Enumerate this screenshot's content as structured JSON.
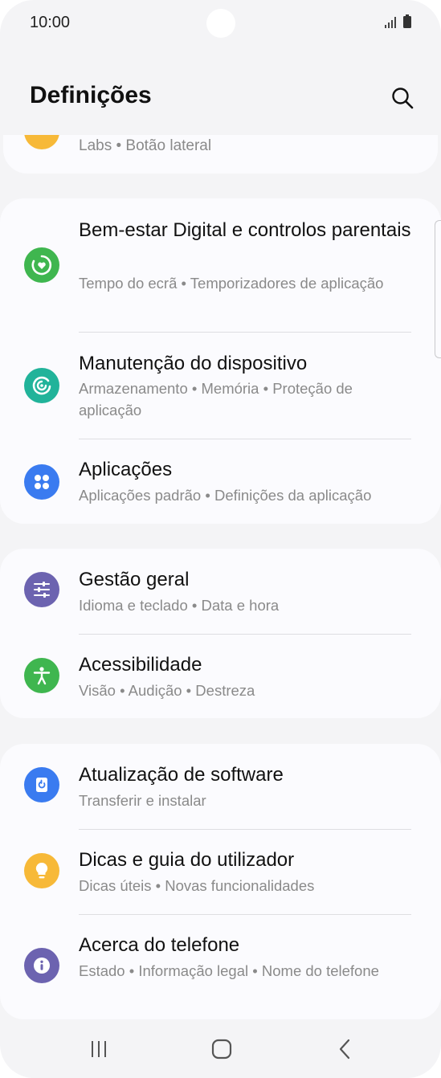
{
  "status": {
    "time": "10:00"
  },
  "header": {
    "title": "Definições"
  },
  "partial_item": {
    "subtitle": "Labs  •  Botão lateral"
  },
  "groups": [
    {
      "items": [
        {
          "title": "Bem-estar Digital e controlos parentais",
          "subtitle": "Tempo do ecrã  •  Temporizadores de aplicação",
          "icon": "digital-wellbeing-icon",
          "color": "#3fb64f"
        },
        {
          "title": "Manutenção do dispositivo",
          "subtitle": "Armazenamento  •  Memória  •  Proteção de aplicação",
          "icon": "device-care-icon",
          "color": "#21b39a"
        },
        {
          "title": "Aplicações",
          "subtitle": "Aplicações padrão  •  Definições da aplicação",
          "icon": "apps-icon",
          "color": "#3a7bf0"
        }
      ]
    },
    {
      "items": [
        {
          "title": "Gestão geral",
          "subtitle": "Idioma e teclado  •  Data e hora",
          "icon": "general-management-icon",
          "color": "#6c63b0"
        },
        {
          "title": "Acessibilidade",
          "subtitle": "Visão  •  Audição  •  Destreza",
          "icon": "accessibility-icon",
          "color": "#3fb64f"
        }
      ]
    },
    {
      "items": [
        {
          "title": "Atualização de software",
          "subtitle": "Transferir e instalar",
          "icon": "software-update-icon",
          "color": "#3a7bf0"
        },
        {
          "title": "Dicas e guia do utilizador",
          "subtitle": "Dicas úteis  •  Novas funcionalidades",
          "icon": "tips-bulb-icon",
          "color": "#f7b938"
        },
        {
          "title": "Acerca do telefone",
          "subtitle": "Estado  •  Informação legal  •  Nome do telefone",
          "icon": "about-phone-info-icon",
          "color": "#6c63b0"
        }
      ]
    }
  ]
}
